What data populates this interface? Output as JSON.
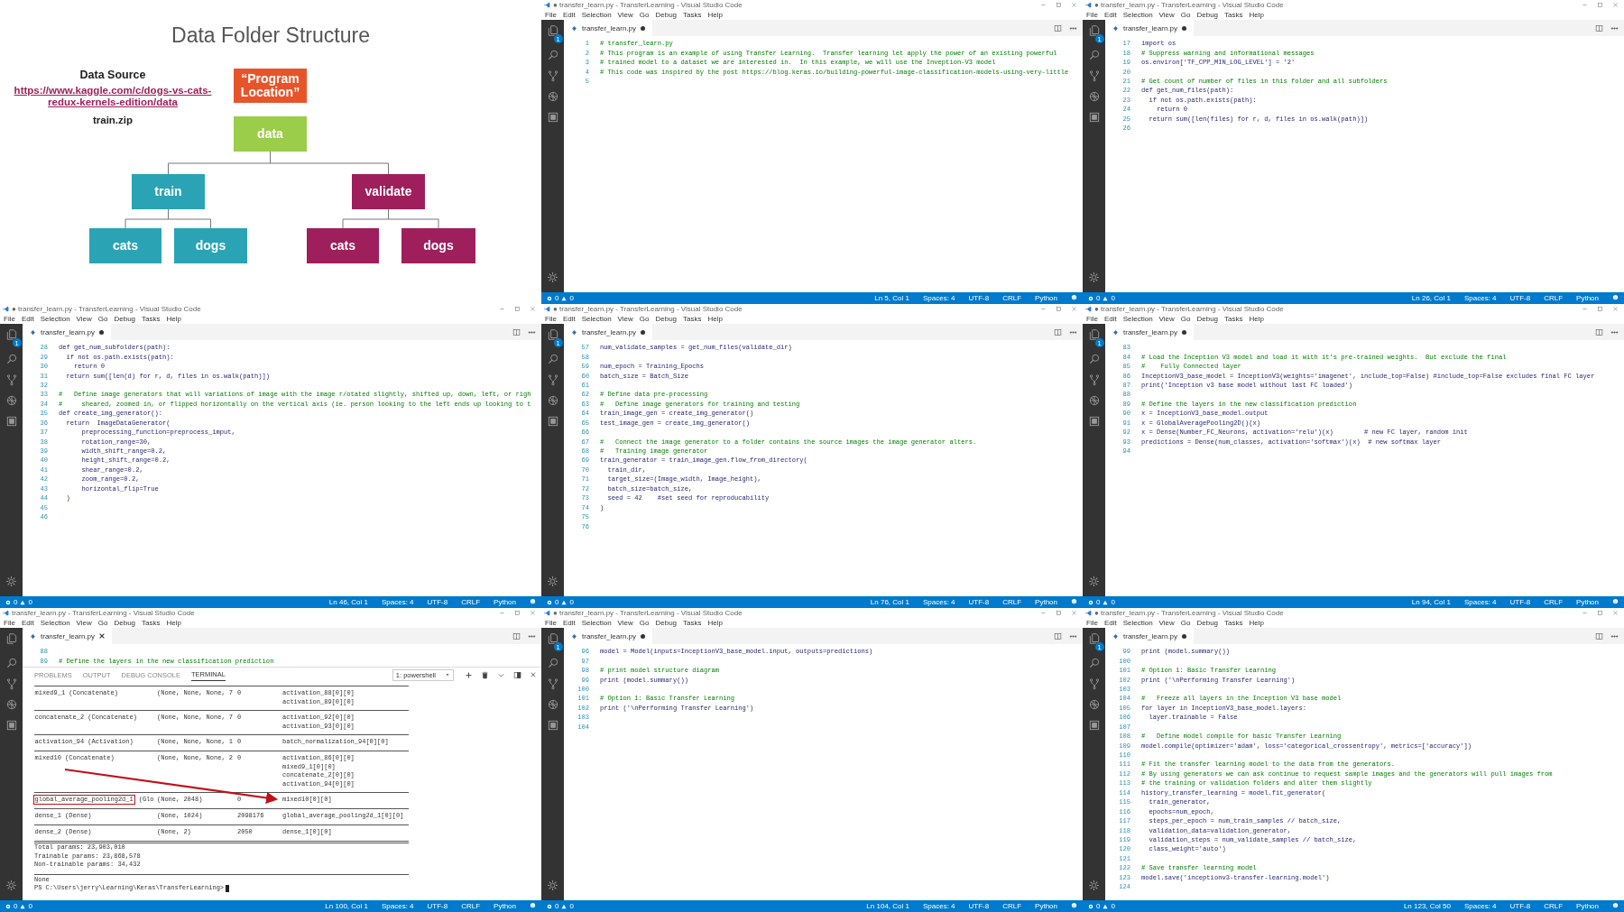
{
  "slide": {
    "title": "Data Folder Structure",
    "source_heading": "Data Source",
    "source_link": "https://www.kaggle.com/c/dogs-vs-cats-redux-kernels-edition/data",
    "source_file": "train.zip",
    "tree": {
      "label": "“Program Location”",
      "color": "#e8542a",
      "children": [
        {
          "label": "data",
          "color": "#9bcc4a",
          "children": [
            {
              "label": "train",
              "color": "#2aa4b5",
              "children": [
                {
                  "label": "cats",
                  "color": "#2aa4b5"
                },
                {
                  "label": "dogs",
                  "color": "#2aa4b5"
                }
              ]
            },
            {
              "label": "validate",
              "color": "#9e1f5c",
              "children": [
                {
                  "label": "cats",
                  "color": "#9e1f5c"
                },
                {
                  "label": "dogs",
                  "color": "#9e1f5c"
                }
              ]
            }
          ]
        }
      ]
    }
  },
  "windows": [
    {
      "title": "● transfer_learn.py - TransferLearning - Visual Studio Code",
      "menu": [
        "File",
        "Edit",
        "Selection",
        "View",
        "Go",
        "Debug",
        "Tasks",
        "Help"
      ],
      "tab": {
        "label": "transfer_learn.py",
        "modified": true
      },
      "badge": "1",
      "lines": [
        {
          "number": "1",
          "kind": "comment",
          "text": "# transfer_learn.py"
        },
        {
          "number": "2",
          "kind": "comment",
          "text": "# This program is an example of using Transfer Learning.  Transfer learning let apply the power of an existing powerful"
        },
        {
          "number": "3",
          "kind": "comment",
          "text": "# trained model to a dataset we are interested in.  In this example, we will use the Inveption-V3 model"
        },
        {
          "number": "4",
          "kind": "comment",
          "text": "# This code was inspired by the post https://blog.keras.io/building-powerful-image-classification-models-using-very-little"
        },
        {
          "number": "5",
          "kind": "blank"
        }
      ],
      "status": {
        "errors": "0",
        "warnings": "0",
        "position": "Ln 5, Col 1",
        "spaces": "Spaces: 4",
        "encoding": "UTF-8",
        "eol": "CRLF",
        "language": "Python"
      }
    },
    {
      "title": "● transfer_learn.py - TransferLearning - Visual Studio Code",
      "menu": [
        "File",
        "Edit",
        "Selection",
        "View",
        "Go",
        "Debug",
        "Tasks",
        "Help"
      ],
      "tab": {
        "label": "transfer_learn.py",
        "modified": true
      },
      "badge": "1",
      "lines": [
        {
          "number": "17",
          "kind": "code",
          "text": "import os"
        },
        {
          "number": "18",
          "kind": "comment",
          "text": "# Suppress warning and informational messages"
        },
        {
          "number": "19",
          "kind": "code",
          "text": "os.environ['TF_CPP_MIN_LOG_LEVEL'] = '2'"
        },
        {
          "number": "20",
          "kind": "blank"
        },
        {
          "number": "21",
          "kind": "comment",
          "text": "# Get count of number of files in this folder and all subfolders"
        },
        {
          "number": "22",
          "kind": "code",
          "text": "def get_num_files(path):"
        },
        {
          "number": "23",
          "kind": "code",
          "text": "  if not os.path.exists(path):"
        },
        {
          "number": "24",
          "kind": "code",
          "text": "    return 0"
        },
        {
          "number": "25",
          "kind": "code",
          "text": "  return sum([len(files) for r, d, files in os.walk(path)])"
        },
        {
          "number": "26",
          "kind": "blank"
        }
      ],
      "status": {
        "errors": "0",
        "warnings": "0",
        "position": "Ln 26, Col 1",
        "spaces": "Spaces: 4",
        "encoding": "UTF-8",
        "eol": "CRLF",
        "language": "Python"
      }
    },
    {
      "title": "● transfer_learn.py - TransferLearning - Visual Studio Code",
      "menu": [
        "File",
        "Edit",
        "Selection",
        "View",
        "Go",
        "Debug",
        "Tasks",
        "Help"
      ],
      "tab": {
        "label": "transfer_learn.py",
        "modified": true
      },
      "badge": "1",
      "lines": [
        {
          "number": "28",
          "kind": "code",
          "text": "def get_num_subfolders(path):"
        },
        {
          "number": "29",
          "kind": "code",
          "text": "  if not os.path.exists(path):"
        },
        {
          "number": "30",
          "kind": "code",
          "text": "    return 0"
        },
        {
          "number": "31",
          "kind": "code",
          "text": "  return sum([len(d) for r, d, files in os.walk(path)])"
        },
        {
          "number": "32",
          "kind": "blank"
        },
        {
          "number": "33",
          "kind": "comment",
          "text": "#   Define image generators that will variations of image with the image r/otated slightly, shifted up, down, left, or righ"
        },
        {
          "number": "34",
          "kind": "comment",
          "text": "#     sheared, zoomed in, or flipped horizontally on the vertical axis (ie. person looking to the left ends up looking to t"
        },
        {
          "number": "35",
          "kind": "code",
          "text": "def create_img_generator():"
        },
        {
          "number": "36",
          "kind": "code",
          "text": "  return  ImageDataGenerator("
        },
        {
          "number": "37",
          "kind": "code",
          "text": "      preprocessing_function=preprocess_imput,"
        },
        {
          "number": "38",
          "kind": "code",
          "text": "      rotation_range=30,"
        },
        {
          "number": "39",
          "kind": "code",
          "text": "      width_shift_range=0.2,"
        },
        {
          "number": "40",
          "kind": "code",
          "text": "      height_shift_range=0.2,"
        },
        {
          "number": "41",
          "kind": "code",
          "text": "      shear_range=0.2,"
        },
        {
          "number": "42",
          "kind": "code",
          "text": "      zoom_range=0.2,"
        },
        {
          "number": "43",
          "kind": "code",
          "text": "      horizontal_flip=True"
        },
        {
          "number": "44",
          "kind": "code",
          "text": "  )"
        },
        {
          "number": "45",
          "kind": "blank"
        },
        {
          "number": "46",
          "kind": "blank"
        }
      ],
      "status": {
        "errors": "0",
        "warnings": "0",
        "position": "Ln 46, Col 1",
        "spaces": "Spaces: 4",
        "encoding": "UTF-8",
        "eol": "CRLF",
        "language": "Python"
      }
    },
    {
      "title": "● transfer_learn.py - TransferLearning - Visual Studio Code",
      "menu": [
        "File",
        "Edit",
        "Selection",
        "View",
        "Go",
        "Debug",
        "Tasks",
        "Help"
      ],
      "tab": {
        "label": "transfer_learn.py",
        "modified": true
      },
      "badge": "1",
      "lines": [
        {
          "number": "57",
          "kind": "code",
          "text": "num_validate_samples = get_num_files(validate_dir)"
        },
        {
          "number": "58",
          "kind": "blank"
        },
        {
          "number": "59",
          "kind": "code",
          "text": "num_epoch = Training_Epochs"
        },
        {
          "number": "60",
          "kind": "code",
          "text": "batch_size = Batch_Size"
        },
        {
          "number": "61",
          "kind": "blank"
        },
        {
          "number": "62",
          "kind": "comment",
          "text": "# Define data pre-processing"
        },
        {
          "number": "63",
          "kind": "comment",
          "text": "#   Define image generators for training and testing"
        },
        {
          "number": "64",
          "kind": "code",
          "text": "train_image_gen = create_img_generator()"
        },
        {
          "number": "65",
          "kind": "code",
          "text": "test_image_gen = create_img_generator()"
        },
        {
          "number": "66",
          "kind": "blank"
        },
        {
          "number": "67",
          "kind": "comment",
          "text": "#   Connect the image generator to a folder contains the source images the image generator alters."
        },
        {
          "number": "68",
          "kind": "comment",
          "text": "#   Training image generator"
        },
        {
          "number": "69",
          "kind": "code",
          "text": "train_generator = train_image_gen.flow_from_directory("
        },
        {
          "number": "70",
          "kind": "code",
          "text": "  train_dir,"
        },
        {
          "number": "71",
          "kind": "code",
          "text": "  target_size=(Image_width, Image_height),"
        },
        {
          "number": "72",
          "kind": "code",
          "text": "  batch_size=batch_size,"
        },
        {
          "number": "73",
          "kind": "code",
          "text": "  seed = 42    #set seed for reproducability"
        },
        {
          "number": "74",
          "kind": "code",
          "text": ")"
        },
        {
          "number": "75",
          "kind": "blank"
        },
        {
          "number": "76",
          "kind": "blank"
        }
      ],
      "status": {
        "errors": "0",
        "warnings": "0",
        "position": "Ln 76, Col 1",
        "spaces": "Spaces: 4",
        "encoding": "UTF-8",
        "eol": "CRLF",
        "language": "Python"
      }
    },
    {
      "title": "● transfer_learn.py - TransferLearning - Visual Studio Code",
      "menu": [
        "File",
        "Edit",
        "Selection",
        "View",
        "Go",
        "Debug",
        "Tasks",
        "Help"
      ],
      "tab": {
        "label": "transfer_learn.py",
        "modified": true
      },
      "badge": "1",
      "lines": [
        {
          "number": "83",
          "kind": "blank"
        },
        {
          "number": "84",
          "kind": "comment",
          "text": "# Load the Inception V3 model and load it with it's pre-trained weights.  But exclude the final"
        },
        {
          "number": "85",
          "kind": "comment",
          "text": "#    Fully Connected layer"
        },
        {
          "number": "86",
          "kind": "code",
          "text": "InceptionV3_base_model = InceptionV3(weights='imagenet', include_top=False) #include_top=False excludes final FC layer"
        },
        {
          "number": "87",
          "kind": "code",
          "text": "print('Inception v3 base model without last FC loaded')"
        },
        {
          "number": "88",
          "kind": "blank"
        },
        {
          "number": "89",
          "kind": "comment",
          "text": "# Define the layers in the new classification prediction"
        },
        {
          "number": "90",
          "kind": "code",
          "text": "x = InceptionV3_base_model.output"
        },
        {
          "number": "91",
          "kind": "code",
          "text": "x = GlobalAveragePooling2D()(x)"
        },
        {
          "number": "92",
          "kind": "code",
          "text": "x = Dense(Number_FC_Neurons, activation='relu')(x)        # new FC layer, random init"
        },
        {
          "number": "93",
          "kind": "code",
          "text": "predictions = Dense(num_classes, activation='softmax')(x)  # new softmax layer"
        },
        {
          "number": "94",
          "kind": "blank"
        }
      ],
      "status": {
        "errors": "0",
        "warnings": "0",
        "position": "Ln 94, Col 1",
        "spaces": "Spaces: 4",
        "encoding": "UTF-8",
        "eol": "CRLF",
        "language": "Python"
      }
    },
    {
      "title": "transfer_learn.py - TransferLearning - Visual Studio Code",
      "menu": [
        "File",
        "Edit",
        "Selection",
        "View",
        "Go",
        "Debug",
        "Tasks",
        "Help"
      ],
      "tab": {
        "label": "transfer_learn.py",
        "modified": false
      },
      "lines": [
        {
          "number": "88",
          "kind": "blank"
        },
        {
          "number": "89",
          "kind": "comment",
          "text": "# Define the layers in the new classification prediction"
        }
      ],
      "terminal": {
        "tabs": [
          {
            "label": "PROBLEMS",
            "selected": false
          },
          {
            "label": "OUTPUT",
            "selected": false
          },
          {
            "label": "DEBUG CONSOLE",
            "selected": false
          },
          {
            "label": "TERMINAL",
            "selected": true
          }
        ],
        "shell": "1: powershell",
        "rows": [
          {
            "layer": "mixed9_1 (Concatenate)",
            "highlighted": false,
            "output_shape": "(None, None, None, 7",
            "params": "0",
            "connected_to": [
              "activation_88[0][0]",
              "activation_89[0][0]"
            ]
          },
          {
            "layer": "concatenate_2 (Concatenate)",
            "highlighted": false,
            "output_shape": "(None, None, None, 7",
            "params": "0",
            "connected_to": [
              "activation_92[0][0]",
              "activation_93[0][0]"
            ]
          },
          {
            "layer": "activation_94 (Activation)",
            "highlighted": false,
            "output_shape": "(None, None, None, 1",
            "params": "0",
            "connected_to": [
              "batch_normalization_94[0][0]"
            ]
          },
          {
            "layer": "mixed10 (Concatenate)",
            "highlighted": false,
            "output_shape": "(None, None, None, 2",
            "params": "0",
            "connected_to": [
              "activation_86[0][0]",
              "mixed9_1[0][0]",
              "concatenate_2[0][0]",
              "activation_94[0][0]"
            ]
          },
          {
            "layer": "global_average_pooling2d_1",
            "highlighted": true,
            "type_cut": "(Glo",
            "output_shape": "(None, 2048)",
            "params": "0",
            "connected_to": [
              "mixed10[0][0]"
            ]
          },
          {
            "layer": "dense_1 (Dense)",
            "highlighted": false,
            "output_shape": "(None, 1024)",
            "params": "2098176",
            "connected_to": [
              "global_average_pooling2d_1[0][0]"
            ]
          },
          {
            "layer": "dense_2 (Dense)",
            "highlighted": false,
            "output_shape": "(None, 2)",
            "params": "2050",
            "connected_to": [
              "dense_1[0][0]"
            ]
          }
        ],
        "summary": [
          "Total params: 23,903,010",
          "Trainable params: 23,868,578",
          "Non-trainable params: 34,432"
        ],
        "output": "None",
        "prompt": "PS C:\\Users\\jerry\\Learning\\Keras\\TransferLearning>"
      },
      "status": {
        "errors": "0",
        "warnings": "0",
        "position": "Ln 100, Col 1",
        "spaces": "Spaces: 4",
        "encoding": "UTF-8",
        "eol": "CRLF",
        "language": "Python"
      }
    },
    {
      "title": "● transfer_learn.py - TransferLearning - Visual Studio Code",
      "menu": [
        "File",
        "Edit",
        "Selection",
        "View",
        "Go",
        "Debug",
        "Tasks",
        "Help"
      ],
      "tab": {
        "label": "transfer_learn.py",
        "modified": true
      },
      "badge": "1",
      "lines": [
        {
          "number": "96",
          "kind": "code",
          "text": "model = Model(inputs=InceptionV3_base_model.input, outputs=predictions)"
        },
        {
          "number": "97",
          "kind": "blank"
        },
        {
          "number": "98",
          "kind": "comment",
          "text": "# print model structure diagram"
        },
        {
          "number": "99",
          "kind": "code",
          "text": "print (model.summary())"
        },
        {
          "number": "100",
          "kind": "blank"
        },
        {
          "number": "101",
          "kind": "comment",
          "text": "# Option 1: Basic Transfer Learning"
        },
        {
          "number": "102",
          "kind": "code",
          "text": "print ('\\nPerforming Transfer Learning')"
        },
        {
          "number": "103",
          "kind": "blank"
        },
        {
          "number": "104",
          "kind": "blank"
        }
      ],
      "status": {
        "errors": "0",
        "warnings": "0",
        "position": "Ln 104, Col 1",
        "spaces": "Spaces: 4",
        "encoding": "UTF-8",
        "eol": "CRLF",
        "language": "Python"
      }
    },
    {
      "title": "● transfer_learn.py - TransferLearning - Visual Studio Code",
      "menu": [
        "File",
        "Edit",
        "Selection",
        "View",
        "Go",
        "Debug",
        "Tasks",
        "Help"
      ],
      "tab": {
        "label": "transfer_learn.py",
        "modified": true
      },
      "badge": "1",
      "lines": [
        {
          "number": "99",
          "kind": "code",
          "text": "print (model.summary())"
        },
        {
          "number": "100",
          "kind": "blank"
        },
        {
          "number": "101",
          "kind": "comment",
          "text": "# Option 1: Basic Transfer Learning"
        },
        {
          "number": "102",
          "kind": "code",
          "text": "print ('\\nPerforming Transfer Learning')"
        },
        {
          "number": "103",
          "kind": "blank"
        },
        {
          "number": "104",
          "kind": "comment",
          "text": "#   Freeze all layers in the Inception V3 base model"
        },
        {
          "number": "105",
          "kind": "code",
          "text": "for layer in InceptionV3_base_model.layers:"
        },
        {
          "number": "106",
          "kind": "code",
          "text": "  layer.trainable = False"
        },
        {
          "number": "107",
          "kind": "blank"
        },
        {
          "number": "108",
          "kind": "comment",
          "text": "#   Define model compile for basic Transfer Learning"
        },
        {
          "number": "109",
          "kind": "code",
          "text": "model.compile(optimizer='adam', loss='categorical_crossentropy', metrics=['accuracy'])"
        },
        {
          "number": "110",
          "kind": "blank"
        },
        {
          "number": "111",
          "kind": "comment",
          "text": "# Fit the transfer learning model to the data from the generators."
        },
        {
          "number": "112",
          "kind": "comment",
          "text": "# By using generators we can ask continue to request sample images and the generators will pull images from"
        },
        {
          "number": "113",
          "kind": "comment",
          "text": "# the training or validation folders and alter them slightly"
        },
        {
          "number": "114",
          "kind": "code",
          "text": "history_transfer_learning = model.fit_generator("
        },
        {
          "number": "115",
          "kind": "code",
          "text": "  train_generator,"
        },
        {
          "number": "116",
          "kind": "code",
          "text": "  epochs=num_epoch,"
        },
        {
          "number": "117",
          "kind": "code",
          "text": "  steps_per_epoch = num_train_samples // batch_size,"
        },
        {
          "number": "118",
          "kind": "code",
          "text": "  validation_data=validation_generator,"
        },
        {
          "number": "119",
          "kind": "code",
          "text": "  validation_steps = num_validate_samples // batch_size,"
        },
        {
          "number": "120",
          "kind": "code",
          "text": "  class_weight='auto')"
        },
        {
          "number": "121",
          "kind": "blank"
        },
        {
          "number": "122",
          "kind": "comment",
          "text": "# Save transfer learning model"
        },
        {
          "number": "123",
          "kind": "code",
          "text": "model.save('inceptionv3-transfer-learning.model')"
        },
        {
          "number": "124",
          "kind": "blank"
        }
      ],
      "status": {
        "errors": "0",
        "warnings": "0",
        "position": "Ln 123, Col 50",
        "spaces": "Spaces: 4",
        "encoding": "UTF-8",
        "eol": "CRLF",
        "language": "Python"
      }
    }
  ]
}
